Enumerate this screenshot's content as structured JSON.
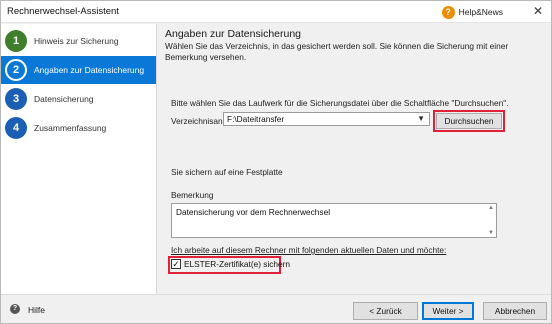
{
  "window": {
    "title": "Rechnerwechsel-Assistent",
    "help_news_label": "Help&News",
    "close_glyph": "✕"
  },
  "sidebar": {
    "steps": [
      {
        "number": "1",
        "label": "Hinweis zur Sicherung",
        "state": "done"
      },
      {
        "number": "2",
        "label": "Angaben zur Datensicherung",
        "state": "active"
      },
      {
        "number": "3",
        "label": "Datensicherung",
        "state": "pending"
      },
      {
        "number": "4",
        "label": "Zusammenfassung",
        "state": "pending"
      }
    ]
  },
  "main": {
    "heading": "Angaben zur Datensicherung",
    "description": "Wählen Sie das Verzeichnis, in das gesichert werden soll. Sie können die Sicherung mit einer Bemerkung versehen.",
    "hint": "Bitte wählen Sie das Laufwerk für die Sicherungsdatei über die Schaltfläche \"Durchsuchen\".",
    "directory_label": "Verzeichnisangabe:",
    "directory_value": "F:\\Dateitransfer",
    "browse_label": "Durchsuchen",
    "disk_info": "Sie sichern auf eine Festplatte",
    "remark_label": "Bemerkung",
    "remark_value": "Datensicherung vor dem Rechnerwechsel",
    "working_note": "Ich arbeite auf diesem Rechner mit folgenden aktuellen Daten und möchte:",
    "elster_label": "ELSTER-Zertifikat(e) sichern",
    "elster_checked": true
  },
  "footer": {
    "help_label": "Hilfe",
    "back_label": "< Zurück",
    "next_label": "Weiter >",
    "cancel_label": "Abbrechen"
  },
  "colors": {
    "active_step": "#0a78d7",
    "done_step": "#3f7f2b",
    "pending_step": "#1b5fb5",
    "highlight_red": "#e0213a"
  }
}
